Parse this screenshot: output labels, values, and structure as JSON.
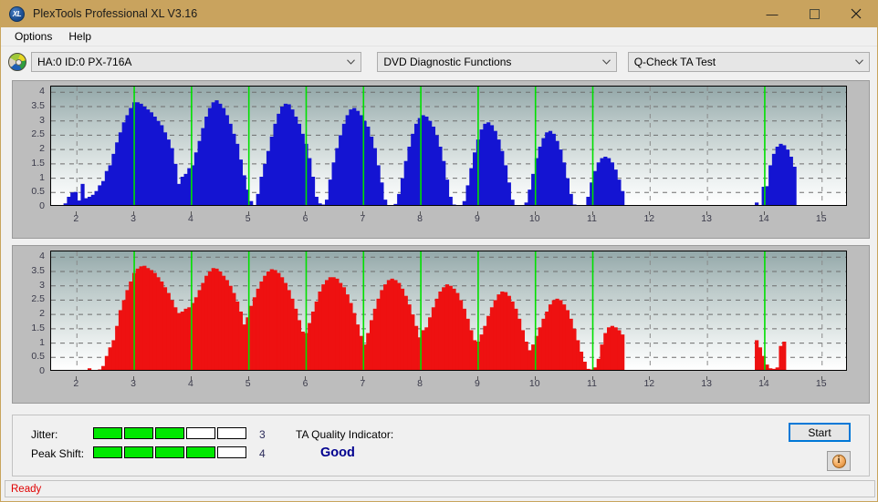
{
  "window": {
    "title": "PlexTools Professional XL V3.16",
    "icon": "xl-logo-icon",
    "minimize_label": "–",
    "maximize_label": "▭",
    "close_label": "✕"
  },
  "menubar": {
    "items": [
      {
        "label": "Options"
      },
      {
        "label": "Help"
      }
    ]
  },
  "toolbar": {
    "drive_icon": "disc-icon",
    "drive_value": "HA:0 ID:0  PX-716A",
    "function_value": "DVD Diagnostic Functions",
    "test_value": "Q-Check TA Test"
  },
  "results": {
    "jitter_label": "Jitter:",
    "jitter_value": "3",
    "jitter_filled": 3,
    "jitter_total": 5,
    "peak_shift_label": "Peak Shift:",
    "peak_shift_value": "4",
    "peak_shift_filled": 4,
    "peak_shift_total": 5,
    "ta_quality_label": "TA Quality Indicator:",
    "ta_quality_value": "Good",
    "ta_quality_color": "#00008f",
    "meter_on_color": "#00e800",
    "start_label": "Start",
    "info_label": "i"
  },
  "statusbar": {
    "text": "Ready",
    "color": "#e00000"
  },
  "chart_data": [
    {
      "id": "jitter-chart",
      "type": "bar",
      "title": "",
      "xlabel": "",
      "ylabel": "",
      "color": "#1414d2",
      "marker_color": "#00e000",
      "ylim": [
        0,
        4.2
      ],
      "yticks": [
        0,
        0.5,
        1,
        1.5,
        2,
        2.5,
        3,
        3.5,
        4
      ],
      "ytick_labels": [
        "0",
        "0.5",
        "1",
        "1.5",
        "2",
        "2.5",
        "3",
        "3.5",
        "4"
      ],
      "xlim": [
        1.55,
        15.45
      ],
      "xticks": [
        2,
        3,
        4,
        5,
        6,
        7,
        8,
        9,
        10,
        11,
        12,
        13,
        14,
        15
      ],
      "xtick_labels": [
        "2",
        "3",
        "4",
        "5",
        "6",
        "7",
        "8",
        "9",
        "10",
        "11",
        "12",
        "13",
        "14",
        "15"
      ],
      "grid": true,
      "markers": [
        3,
        4,
        5,
        6,
        7,
        8,
        9,
        10,
        11,
        14
      ],
      "x": [
        1.62,
        1.68,
        1.74,
        1.8,
        1.86,
        1.92,
        1.98,
        2.04,
        2.1,
        2.16,
        2.22,
        2.28,
        2.34,
        2.4,
        2.46,
        2.52,
        2.58,
        2.64,
        2.7,
        2.76,
        2.82,
        2.88,
        2.94,
        3.0,
        3.06,
        3.12,
        3.18,
        3.24,
        3.3,
        3.36,
        3.42,
        3.48,
        3.54,
        3.6,
        3.66,
        3.72,
        3.78,
        3.84,
        3.9,
        3.96,
        4.02,
        4.08,
        4.14,
        4.2,
        4.26,
        4.32,
        4.38,
        4.44,
        4.5,
        4.56,
        4.62,
        4.68,
        4.74,
        4.8,
        4.86,
        4.92,
        4.98,
        5.04,
        5.1,
        5.16,
        5.22,
        5.28,
        5.34,
        5.4,
        5.46,
        5.52,
        5.58,
        5.64,
        5.7,
        5.76,
        5.82,
        5.88,
        5.94,
        6.0,
        6.06,
        6.12,
        6.18,
        6.24,
        6.3,
        6.36,
        6.42,
        6.48,
        6.54,
        6.6,
        6.66,
        6.72,
        6.78,
        6.84,
        6.9,
        6.96,
        7.02,
        7.08,
        7.14,
        7.2,
        7.26,
        7.32,
        7.38,
        7.44,
        7.5,
        7.56,
        7.62,
        7.68,
        7.74,
        7.8,
        7.86,
        7.92,
        7.98,
        8.04,
        8.1,
        8.16,
        8.22,
        8.28,
        8.34,
        8.4,
        8.46,
        8.52,
        8.58,
        8.64,
        8.7,
        8.76,
        8.82,
        8.88,
        8.94,
        9.0,
        9.06,
        9.12,
        9.18,
        9.24,
        9.3,
        9.36,
        9.42,
        9.48,
        9.54,
        9.6,
        9.66,
        9.72,
        9.78,
        9.84,
        9.9,
        9.96,
        10.02,
        10.08,
        10.14,
        10.2,
        10.26,
        10.32,
        10.38,
        10.44,
        10.5,
        10.56,
        10.62,
        10.68,
        10.74,
        10.8,
        10.86,
        10.92,
        10.98,
        11.04,
        11.1,
        11.16,
        11.22,
        11.28,
        11.34,
        11.4,
        11.46,
        11.52,
        13.86,
        13.92,
        13.98,
        14.04,
        14.1,
        14.16,
        14.22,
        14.28,
        14.34,
        14.4,
        14.46,
        14.52
      ],
      "values": [
        0.04,
        0.05,
        0.05,
        0.12,
        0.35,
        0.5,
        0.52,
        0.22,
        0.8,
        0.3,
        0.35,
        0.42,
        0.55,
        0.75,
        0.9,
        1.25,
        1.45,
        1.85,
        2.25,
        2.6,
        2.95,
        3.2,
        3.45,
        3.65,
        3.65,
        3.6,
        3.5,
        3.4,
        3.3,
        3.15,
        3.0,
        2.85,
        2.6,
        2.35,
        2.05,
        1.5,
        0.8,
        1.05,
        1.15,
        1.35,
        1.45,
        1.9,
        2.3,
        2.75,
        3.15,
        3.45,
        3.65,
        3.72,
        3.6,
        3.45,
        3.2,
        2.9,
        2.55,
        2.2,
        1.65,
        1.1,
        0.6,
        0.2,
        0.05,
        0.45,
        1.05,
        1.5,
        1.95,
        2.45,
        2.9,
        3.25,
        3.5,
        3.6,
        3.58,
        3.4,
        3.15,
        2.9,
        2.55,
        2.2,
        1.7,
        1.05,
        0.35,
        0.12,
        0.08,
        0.25,
        0.95,
        1.55,
        2.05,
        2.5,
        2.9,
        3.2,
        3.4,
        3.45,
        3.35,
        3.2,
        3.0,
        2.8,
        2.45,
        2.05,
        1.45,
        0.85,
        0.25,
        0.05,
        0.05,
        0.1,
        0.45,
        1.0,
        1.6,
        2.1,
        2.55,
        2.9,
        3.1,
        3.2,
        3.15,
        3.0,
        2.8,
        2.5,
        2.1,
        1.6,
        0.95,
        0.35,
        0.08,
        0.05,
        0.05,
        0.2,
        0.75,
        1.35,
        1.9,
        2.35,
        2.7,
        2.9,
        2.95,
        2.85,
        2.65,
        2.35,
        1.95,
        1.45,
        0.85,
        0.25,
        0.05,
        0.03,
        0.05,
        0.15,
        0.6,
        1.15,
        1.7,
        2.1,
        2.4,
        2.6,
        2.65,
        2.55,
        2.3,
        2.0,
        1.55,
        1.0,
        0.45,
        0.08,
        0.03,
        0.02,
        0.05,
        0.35,
        0.85,
        1.25,
        1.55,
        1.7,
        1.75,
        1.7,
        1.55,
        1.3,
        0.95,
        0.55,
        0.15,
        0.03,
        0.7,
        0.72,
        1.45,
        1.85,
        2.1,
        2.2,
        2.15,
        2.0,
        1.75,
        1.4,
        0.95,
        0.7
      ]
    },
    {
      "id": "peak-shift-chart",
      "type": "bar",
      "title": "",
      "xlabel": "",
      "ylabel": "",
      "color": "#ee1111",
      "marker_color": "#00e000",
      "ylim": [
        0,
        4.2
      ],
      "yticks": [
        0,
        0.5,
        1,
        1.5,
        2,
        2.5,
        3,
        3.5,
        4
      ],
      "ytick_labels": [
        "0",
        "0.5",
        "1",
        "1.5",
        "2",
        "2.5",
        "3",
        "3.5",
        "4"
      ],
      "xlim": [
        1.55,
        15.45
      ],
      "xticks": [
        2,
        3,
        4,
        5,
        6,
        7,
        8,
        9,
        10,
        11,
        12,
        13,
        14,
        15
      ],
      "xtick_labels": [
        "2",
        "3",
        "4",
        "5",
        "6",
        "7",
        "8",
        "9",
        "10",
        "11",
        "12",
        "13",
        "14",
        "15"
      ],
      "grid": true,
      "markers": [
        3,
        4,
        5,
        6,
        7,
        8,
        9,
        10,
        11,
        14
      ],
      "x": [
        2.22,
        2.28,
        2.34,
        2.4,
        2.46,
        2.52,
        2.58,
        2.64,
        2.7,
        2.76,
        2.82,
        2.88,
        2.94,
        3.0,
        3.06,
        3.12,
        3.18,
        3.24,
        3.3,
        3.36,
        3.42,
        3.48,
        3.54,
        3.6,
        3.66,
        3.72,
        3.78,
        3.84,
        3.9,
        3.96,
        4.02,
        4.08,
        4.14,
        4.2,
        4.26,
        4.32,
        4.38,
        4.44,
        4.5,
        4.56,
        4.62,
        4.68,
        4.74,
        4.8,
        4.86,
        4.92,
        4.98,
        5.04,
        5.1,
        5.16,
        5.22,
        5.28,
        5.34,
        5.4,
        5.46,
        5.52,
        5.58,
        5.64,
        5.7,
        5.76,
        5.82,
        5.88,
        5.94,
        6.0,
        6.06,
        6.12,
        6.18,
        6.24,
        6.3,
        6.36,
        6.42,
        6.48,
        6.54,
        6.6,
        6.66,
        6.72,
        6.78,
        6.84,
        6.9,
        6.96,
        7.02,
        7.08,
        7.14,
        7.2,
        7.26,
        7.32,
        7.38,
        7.44,
        7.5,
        7.56,
        7.62,
        7.68,
        7.74,
        7.8,
        7.86,
        7.92,
        7.98,
        8.04,
        8.1,
        8.16,
        8.22,
        8.28,
        8.34,
        8.4,
        8.46,
        8.52,
        8.58,
        8.64,
        8.7,
        8.76,
        8.82,
        8.88,
        8.94,
        9.0,
        9.06,
        9.12,
        9.18,
        9.24,
        9.3,
        9.36,
        9.42,
        9.48,
        9.54,
        9.6,
        9.66,
        9.72,
        9.78,
        9.84,
        9.9,
        9.96,
        10.02,
        10.08,
        10.14,
        10.2,
        10.26,
        10.32,
        10.38,
        10.44,
        10.5,
        10.56,
        10.62,
        10.68,
        10.74,
        10.8,
        10.86,
        10.92,
        10.98,
        11.04,
        11.1,
        11.16,
        11.22,
        11.28,
        11.34,
        11.4,
        11.46,
        11.52,
        13.86,
        13.92,
        13.98,
        14.04,
        14.1,
        14.16,
        14.22,
        14.28,
        14.34
      ],
      "values": [
        0.12,
        0.04,
        0.05,
        0.08,
        0.2,
        0.55,
        0.85,
        1.1,
        1.6,
        2.15,
        2.5,
        2.85,
        3.15,
        3.45,
        3.6,
        3.68,
        3.7,
        3.62,
        3.55,
        3.45,
        3.3,
        3.15,
        2.95,
        2.75,
        2.5,
        2.25,
        2.05,
        2.1,
        2.2,
        2.25,
        2.4,
        2.6,
        2.85,
        3.1,
        3.35,
        3.5,
        3.62,
        3.6,
        3.5,
        3.35,
        3.2,
        3.0,
        2.75,
        2.45,
        2.1,
        1.65,
        1.9,
        2.3,
        2.6,
        2.9,
        3.15,
        3.35,
        3.5,
        3.58,
        3.55,
        3.45,
        3.3,
        3.1,
        2.85,
        2.55,
        2.2,
        1.8,
        1.4,
        1.35,
        1.7,
        2.1,
        2.45,
        2.8,
        3.05,
        3.2,
        3.3,
        3.3,
        3.25,
        3.1,
        2.95,
        2.7,
        2.4,
        2.05,
        1.65,
        1.25,
        0.95,
        1.35,
        1.8,
        2.2,
        2.55,
        2.85,
        3.05,
        3.2,
        3.25,
        3.2,
        3.1,
        2.9,
        2.65,
        2.35,
        2.0,
        1.6,
        1.2,
        1.45,
        1.55,
        1.9,
        2.25,
        2.55,
        2.8,
        2.95,
        3.05,
        3.0,
        2.9,
        2.75,
        2.5,
        2.2,
        1.85,
        1.45,
        1.1,
        1.05,
        1.3,
        1.6,
        1.95,
        2.25,
        2.5,
        2.7,
        2.8,
        2.78,
        2.65,
        2.45,
        2.2,
        1.85,
        1.45,
        1.05,
        0.75,
        0.95,
        1.25,
        1.55,
        1.85,
        2.1,
        2.35,
        2.5,
        2.55,
        2.5,
        2.35,
        2.15,
        1.85,
        1.5,
        1.1,
        0.7,
        0.35,
        0.1,
        0.08,
        0.15,
        0.45,
        0.95,
        1.35,
        1.55,
        1.6,
        1.55,
        1.45,
        1.3,
        1.1,
        0.85,
        0.55,
        0.25,
        0.12,
        0.1,
        0.15,
        0.9,
        1.05,
        1.2,
        1.15,
        1.0,
        0.8,
        0.45,
        0.15
      ]
    }
  ]
}
